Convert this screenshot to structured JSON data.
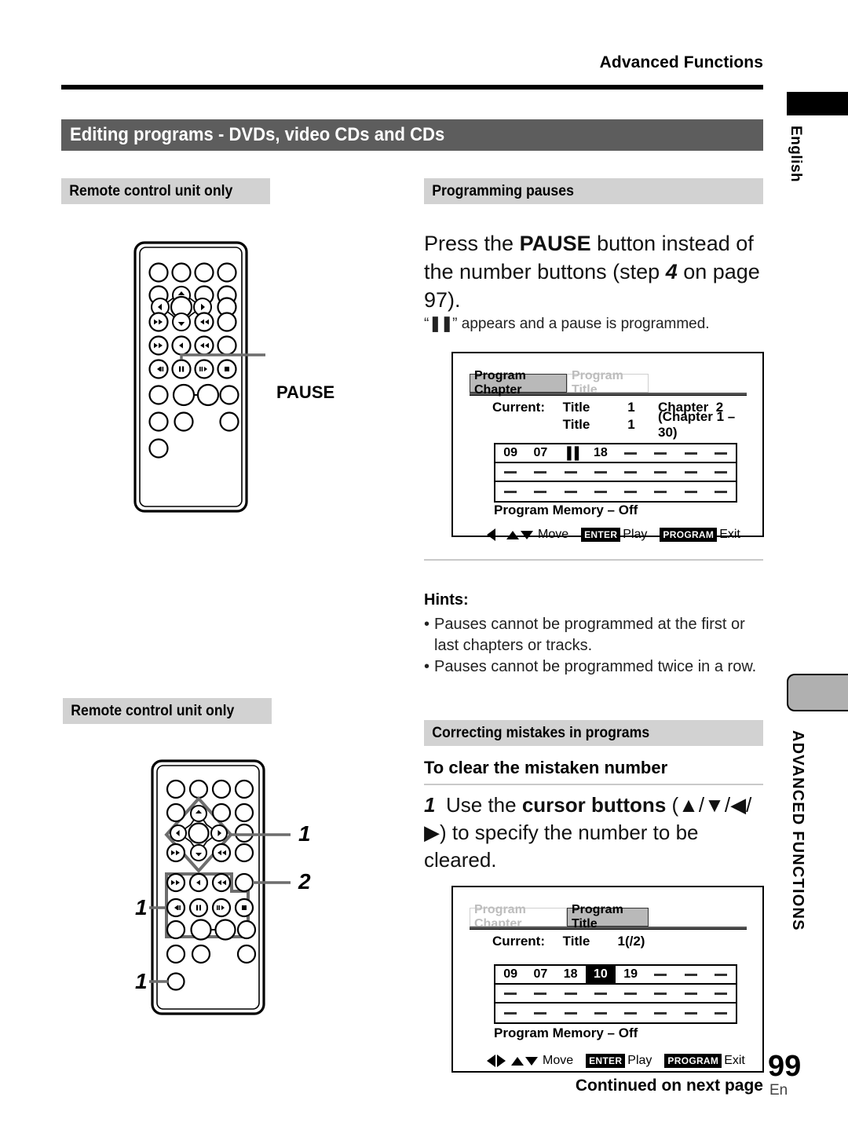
{
  "header": {
    "running_head": "Advanced Functions",
    "title": "Editing programs - DVDs, video CDs and CDs"
  },
  "margin_tabs": {
    "language": "English",
    "section": "ADVANCED FUNCTIONS"
  },
  "left_column": {
    "section_head_1": "Remote control unit only",
    "section_head_2": "Remote control unit only",
    "remote1_callout": "PAUSE",
    "remote2_callouts": {
      "cursor": "1",
      "enter": "2",
      "transport": "1",
      "program": "1"
    }
  },
  "right_column": {
    "section_head_programming_pauses": "Programming pauses",
    "lead_before_bold": "Press the ",
    "lead_bold": "PAUSE",
    "lead_mid": " button instead of the number buttons (step ",
    "lead_italic_step": "4",
    "lead_after": " on page 97).",
    "sub_note_pre": "“",
    "sub_note_glyph": "▐▐",
    "sub_note_post": "” appears and a pause is programmed.",
    "hints_title": "Hints:",
    "hints": [
      "Pauses cannot be programmed at the first or last chapters or tracks.",
      "Pauses cannot be programmed twice in a row."
    ],
    "section_head_correcting": "Correcting mistakes in programs",
    "subhead_clear": "To clear the mistaken number",
    "step1_number": "1",
    "step1_pre": "Use the ",
    "step1_bold": "cursor buttons",
    "step1_arrows": " (▲/▼/◀/▶)",
    "step1_post": " to specify the number to be cleared."
  },
  "osd1": {
    "tab_active": "Program Chapter",
    "tab_inactive": "Program Title",
    "current_label": "Current:",
    "current_title_label": "Title",
    "current_title_value": "1",
    "current_chapter_label": "Chapter",
    "current_chapter_value": "2",
    "row2_title_label": "Title",
    "row2_title_value": "1",
    "row2_range": "(Chapter 1 – 30)",
    "program_rows": [
      [
        "09",
        "07",
        "❚❚",
        "18",
        "—",
        "—",
        "—",
        "—"
      ],
      [
        "—",
        "—",
        "—",
        "—",
        "—",
        "—",
        "—",
        "—"
      ],
      [
        "—",
        "—",
        "—",
        "—",
        "—",
        "—",
        "—",
        "—"
      ]
    ],
    "highlight_index": -1,
    "program_memory": "Program Memory – Off",
    "footer": {
      "move_label": "Move",
      "enter_key": "ENTER",
      "enter_label": "Play",
      "program_key": "PROGRAM",
      "program_label": "Exit"
    }
  },
  "osd2": {
    "tab_inactive": "Program Chapter",
    "tab_active": "Program Title",
    "current_label": "Current:",
    "current_title_label": "Title",
    "current_title_value": "1(/2)",
    "program_rows": [
      [
        "09",
        "07",
        "18",
        "10",
        "19",
        "—",
        "—",
        "—"
      ],
      [
        "—",
        "—",
        "—",
        "—",
        "—",
        "—",
        "—",
        "—"
      ],
      [
        "—",
        "—",
        "—",
        "—",
        "—",
        "—",
        "—",
        "—"
      ]
    ],
    "highlight_index": 3,
    "program_memory": "Program Memory – Off",
    "footer": {
      "move_label": "Move",
      "enter_key": "ENTER",
      "enter_label": "Play",
      "program_key": "PROGRAM",
      "program_label": "Exit"
    }
  },
  "footer": {
    "continued": "Continued on next page",
    "page_number": "99",
    "page_lang": "En"
  },
  "colors": {
    "title_bar": "#5d5d5d",
    "section_head": "#d2d2d2",
    "tab_active": "#b9b9b9",
    "highlight": "#000000"
  }
}
